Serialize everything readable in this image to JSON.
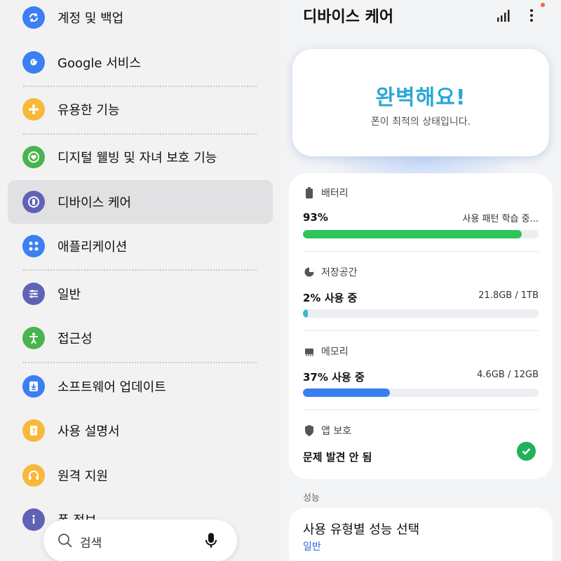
{
  "left_menu": {
    "items": [
      {
        "label": "계정 및 백업",
        "icon": "sync-icon",
        "color": "#3b7ff2"
      },
      {
        "label": "Google 서비스",
        "icon": "google-icon",
        "color": "#3b7ff2"
      },
      {
        "label": "유용한 기능",
        "icon": "puzzle-icon",
        "color": "#f8b83a"
      },
      {
        "label": "디지털 웰빙 및 자녀 보호 기능",
        "icon": "wellbeing-icon",
        "color": "#49b44e"
      },
      {
        "label": "디바이스 케어",
        "icon": "device-care-icon",
        "color": "#6063b5"
      },
      {
        "label": "애플리케이션",
        "icon": "apps-icon",
        "color": "#3b7ff2"
      },
      {
        "label": "일반",
        "icon": "sliders-icon",
        "color": "#6063b5"
      },
      {
        "label": "접근성",
        "icon": "accessibility-icon",
        "color": "#49b44e"
      },
      {
        "label": "소프트웨어 업데이트",
        "icon": "download-icon",
        "color": "#3b7ff2"
      },
      {
        "label": "사용 설명서",
        "icon": "manual-icon",
        "color": "#f8b83a"
      },
      {
        "label": "원격 지원",
        "icon": "headset-icon",
        "color": "#f8b83a"
      },
      {
        "label": "폰 정보",
        "icon": "info-icon",
        "color": "#6063b5"
      }
    ],
    "selected_label": "디바이스 케어"
  },
  "search": {
    "placeholder": "검색",
    "icon": "search-icon",
    "mic_icon": "microphone-icon"
  },
  "device_care": {
    "title": "디바이스 케어",
    "hero": {
      "title": "완벽해요!",
      "subtitle": "폰이 최적의 상태입니다."
    },
    "battery": {
      "label": "배터리",
      "value": "93%",
      "info": "사용 패턴 학습 중...",
      "percent": 93,
      "color": "#2ec45a"
    },
    "storage": {
      "label": "저장공간",
      "value": "2% 사용 중",
      "info": "21.8GB / 1TB",
      "percent": 2,
      "color": "#39b9d2"
    },
    "memory": {
      "label": "메모리",
      "value": "37% 사용 중",
      "info": "4.6GB / 12GB",
      "percent": 37,
      "color": "#3a7ff2"
    },
    "app_protection": {
      "label": "앱 보호",
      "value": "문제 발견 안 됨",
      "status_icon": "check-icon",
      "color": "#22b05a"
    },
    "performance": {
      "section_label": "성능",
      "title": "사용 유형별 성능 선택",
      "subtitle": "일반"
    }
  }
}
